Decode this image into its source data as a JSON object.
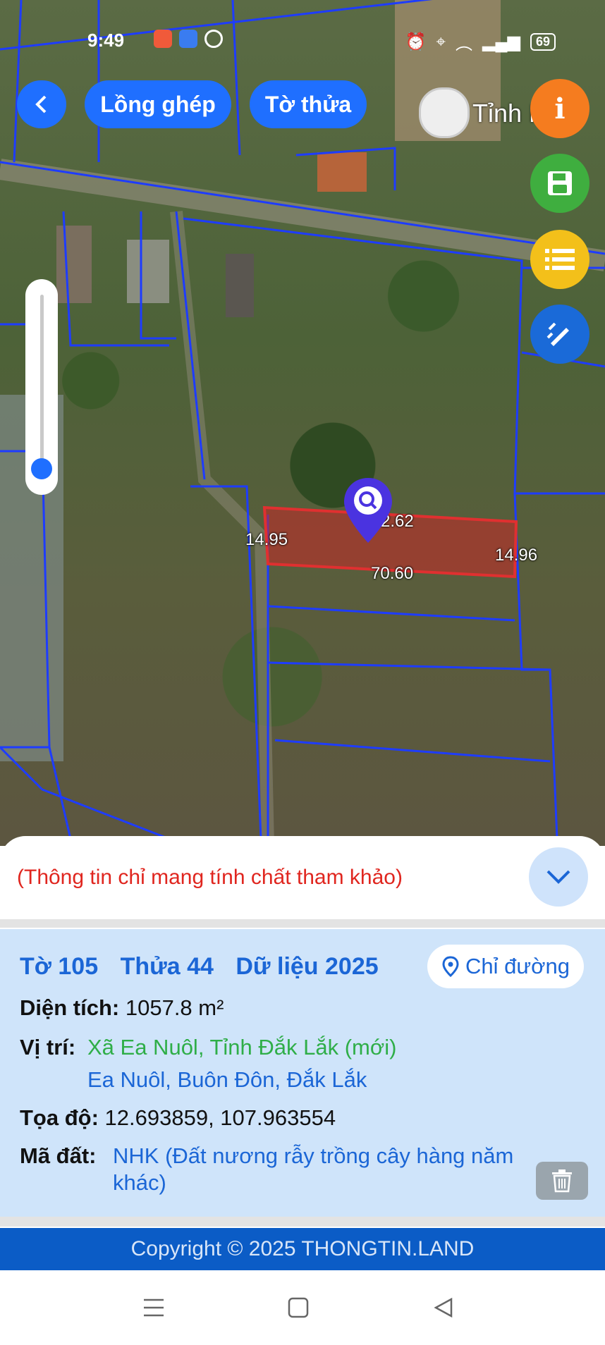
{
  "status_bar": {
    "time": "9:49",
    "battery": "69"
  },
  "toolbar": {
    "layer_button": "Lồng ghép",
    "sheet_button": "Tờ thửa",
    "province_label": "Tỉnh Ng"
  },
  "map": {
    "dimensions": {
      "left": "14.95",
      "top": "2.62",
      "bottom": "70.60",
      "right": "14.96"
    }
  },
  "notice": "(Thông tin chỉ mang tính chất tham khảo)",
  "parcel": {
    "sheet": "Tờ 105",
    "plot": "Thửa 44",
    "data_year": "Dữ liệu 2025",
    "route_button": "Chỉ đường",
    "area_label": "Diện tích:",
    "area_value": "1057.8 m²",
    "location_label": "Vị trí:",
    "location_new": "Xã Ea Nuôl, Tỉnh Đắk Lắk (mới)",
    "location_old": "Ea Nuôl, Buôn Đôn, Đắk Lắk",
    "coords_label": "Tọa độ:",
    "coords_value": "12.693859, 107.963554",
    "land_code_label": "Mã đất:",
    "land_code_line1": "NHK (Đất nương rẫy trồng cây hàng năm",
    "land_code_line2": "khác)"
  },
  "footer": "Copyright © 2025 THONGTIN.LAND",
  "colors": {
    "accent": "#1f6fff",
    "info_bg": "#cfe4fa",
    "notice": "#e0261f",
    "location_new": "#2fae48",
    "footer_bg": "#0b5cc6"
  },
  "icons": [
    "back-icon",
    "info-icon",
    "save-icon",
    "list-icon",
    "draw-icon",
    "location-pin-icon",
    "chevron-down-icon",
    "trash-icon",
    "parcel-marker-icon"
  ]
}
